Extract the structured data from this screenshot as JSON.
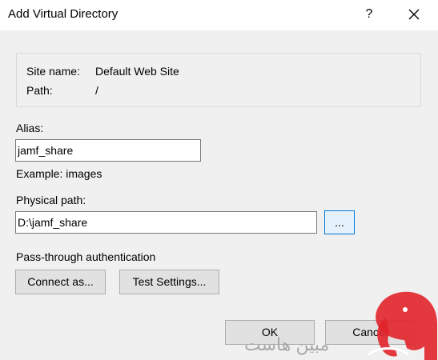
{
  "window": {
    "title": "Add Virtual Directory",
    "help_glyph": "?"
  },
  "info": {
    "site_name_label": "Site name:",
    "site_name_value": "Default Web Site",
    "path_label": "Path:",
    "path_value": "/"
  },
  "alias": {
    "label": "Alias:",
    "value": "jamf_share",
    "example": "Example: images"
  },
  "physical_path": {
    "label": "Physical path:",
    "value": "D:\\jamf_share",
    "browse_label": "..."
  },
  "authentication": {
    "label": "Pass-through authentication",
    "connect_as_label": "Connect as...",
    "test_settings_label": "Test Settings..."
  },
  "footer": {
    "ok_label": "OK",
    "cancel_label": "Cancel"
  },
  "watermark": {
    "text": "مبین هاست",
    "accent_color": "#e2232b"
  }
}
